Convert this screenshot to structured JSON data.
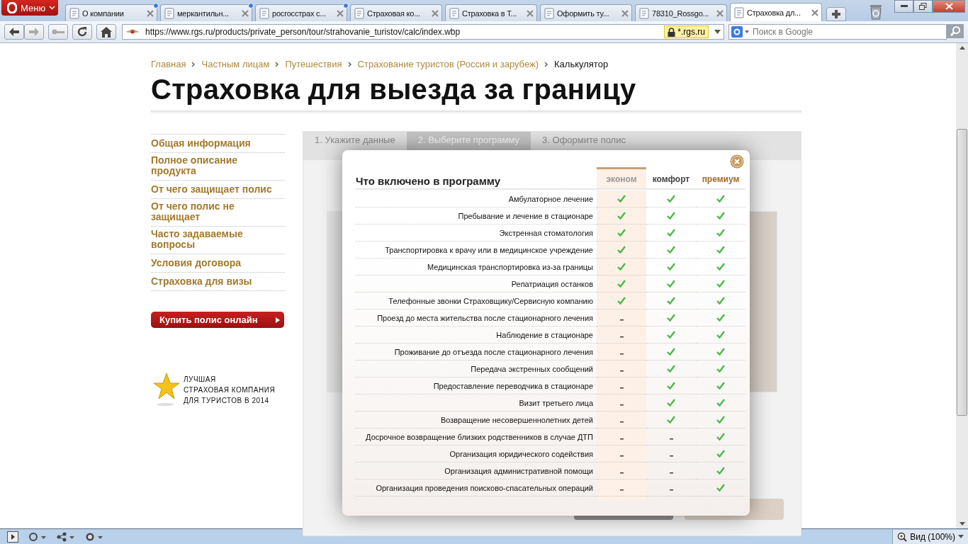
{
  "browser": {
    "menu_button": "Меню",
    "tabs": [
      {
        "title": "О компании",
        "selected": false,
        "has_update": true
      },
      {
        "title": "меркантильн...",
        "selected": false,
        "has_update": true
      },
      {
        "title": "росгосстрах с...",
        "selected": false,
        "has_update": true
      },
      {
        "title": "Страховая ко...",
        "selected": false,
        "has_update": false
      },
      {
        "title": "Страховка в Т...",
        "selected": false,
        "has_update": false
      },
      {
        "title": "Оформить ту...",
        "selected": false,
        "has_update": false
      },
      {
        "title": "78310_Rossgo...",
        "selected": false,
        "has_update": false
      },
      {
        "title": "Страховка дл...",
        "selected": true,
        "has_update": false
      }
    ],
    "address": "https://www.rgs.ru/products/private_person/tour/strahovanie_turistov/calc/index.wbp",
    "security_badge": "*.rgs.ru",
    "search_placeholder": "Поиск в Google",
    "zoom": "Вид (100%)"
  },
  "breadcrumb": [
    {
      "label": "Главная",
      "current": false
    },
    {
      "label": "Частным лицам",
      "current": false
    },
    {
      "label": "Путешествия",
      "current": false
    },
    {
      "label": "Страхование туристов (Россия и зарубеж)",
      "current": false
    },
    {
      "label": "Калькулятор",
      "current": true
    }
  ],
  "page_title": "Страховка для выезда за границу",
  "sidebar": {
    "items": [
      "Общая информация",
      "Полное описание продукта",
      "От чего защищает полис",
      "От чего полис не защищает",
      "Часто задаваемые вопросы",
      "Условия договора",
      "Страховка для визы"
    ],
    "buy_button": "Купить полис онлайн",
    "award_lines": [
      "ЛУЧШАЯ",
      "СТРАХОВАЯ КОМПАНИЯ",
      "ДЛЯ ТУРИСТОВ В 2014"
    ]
  },
  "steps": [
    {
      "label": "1. Укажите данные",
      "selected": false
    },
    {
      "label": "2. Выберите программу",
      "selected": true
    },
    {
      "label": "3. Оформите полис",
      "selected": false
    }
  ],
  "modal": {
    "title": "Что включено в программу",
    "columns": [
      {
        "label": "эконом",
        "selected": true
      },
      {
        "label": "комфорт",
        "selected": false
      },
      {
        "label": "премиум",
        "selected": false
      }
    ],
    "rows": [
      {
        "label": "Амбулаторное лечение",
        "included": [
          true,
          true,
          true
        ]
      },
      {
        "label": "Пребывание и лечение в стационаре",
        "included": [
          true,
          true,
          true
        ]
      },
      {
        "label": "Экстренная стоматология",
        "included": [
          true,
          true,
          true
        ]
      },
      {
        "label": "Транспортировка к врачу или в медицинское учреждение",
        "included": [
          true,
          true,
          true
        ]
      },
      {
        "label": "Медицинская транспортировка из-за границы",
        "included": [
          true,
          true,
          true
        ]
      },
      {
        "label": "Репатриация останков",
        "included": [
          true,
          true,
          true
        ]
      },
      {
        "label": "Телефонные звонки Страховщику/Сервисную компанию",
        "included": [
          true,
          true,
          true
        ]
      },
      {
        "label": "Проезд до места жительства после стационарного лечения",
        "included": [
          false,
          true,
          true
        ]
      },
      {
        "label": "Наблюдение в стационаре",
        "included": [
          false,
          true,
          true
        ]
      },
      {
        "label": "Проживание до отъезда после стационарного лечения",
        "included": [
          false,
          true,
          true
        ]
      },
      {
        "label": "Передача экстренных сообщений",
        "included": [
          false,
          true,
          true
        ]
      },
      {
        "label": "Предоставление переводчика в стационаре",
        "included": [
          false,
          true,
          true
        ]
      },
      {
        "label": "Визит третьего лица",
        "included": [
          false,
          true,
          true
        ]
      },
      {
        "label": "Возвращение несовершеннолетних детей",
        "included": [
          false,
          true,
          true
        ]
      },
      {
        "label": "Досрочное возвращение близких родственников в случае ДТП",
        "included": [
          false,
          false,
          true
        ]
      },
      {
        "label": "Организация юридического содействия",
        "included": [
          false,
          false,
          true
        ]
      },
      {
        "label": "Организация административной помощи",
        "included": [
          false,
          false,
          true
        ]
      },
      {
        "label": "Организация проведения поисково-спасательных операций",
        "included": [
          false,
          false,
          true
        ]
      }
    ]
  }
}
